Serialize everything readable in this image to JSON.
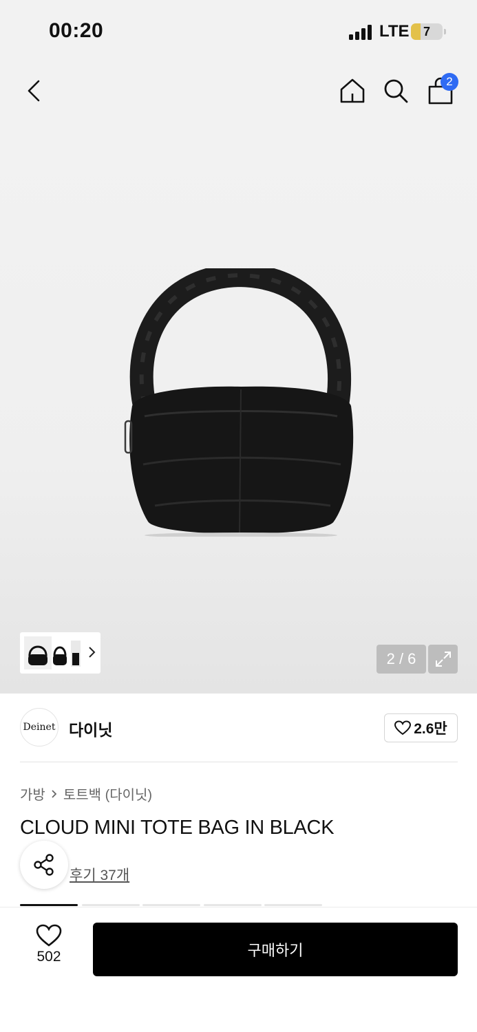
{
  "status_bar": {
    "time": "00:20",
    "network": "LTE",
    "battery": "7"
  },
  "nav": {
    "cart_count": "2",
    "icons": [
      "back-arrow-icon",
      "home-icon",
      "search-icon",
      "shopping-bag-icon"
    ]
  },
  "gallery": {
    "counter": "2 / 6",
    "current_image": 2,
    "total_images": 6
  },
  "brand": {
    "logo_text": "Deinet",
    "name": "다이닛",
    "likes": "2.6만"
  },
  "breadcrumb": {
    "category": "가방",
    "subcategory": "토트백 (다이닛)"
  },
  "product": {
    "title": "CLOUD MINI TOTE BAG IN BLACK",
    "reviews_label": "후기 37개"
  },
  "bottom_bar": {
    "wish_count": "502",
    "buy_label": "구매하기"
  },
  "colors": {
    "badge_blue": "#2f6bf3",
    "buy_button": "#000000",
    "hero_background": "#f2f2f2"
  }
}
